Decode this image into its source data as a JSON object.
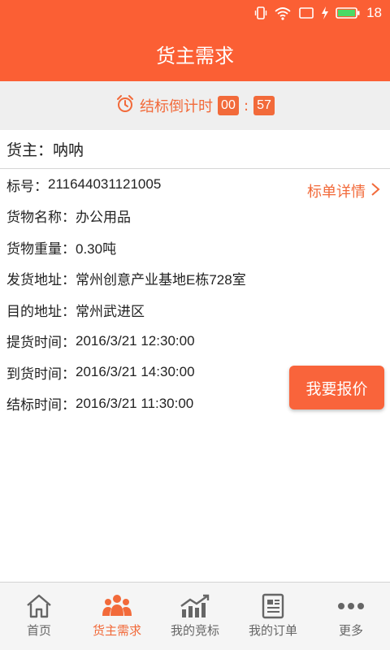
{
  "status_bar": {
    "battery_level": "18",
    "accent": "#fb5f34"
  },
  "header": {
    "title": "货主需求"
  },
  "countdown": {
    "label": "结标倒计时",
    "minutes": "00",
    "separator": ":",
    "seconds": "57"
  },
  "owner": {
    "label": "货主：",
    "name": "呐呐"
  },
  "details": [
    {
      "label": "标号：",
      "value": "211644031121005"
    },
    {
      "label": "货物名称：",
      "value": "办公用品"
    },
    {
      "label": "货物重量：",
      "value": "0.30吨"
    },
    {
      "label": "发货地址：",
      "value": "常州创意产业基地E栋728室"
    },
    {
      "label": "目的地址：",
      "value": "常州武进区"
    },
    {
      "label": "提货时间：",
      "value": "2016/3/21 12:30:00"
    },
    {
      "label": "到货时间：",
      "value": "2016/3/21 14:30:00"
    },
    {
      "label": "结标时间：",
      "value": "2016/3/21 11:30:00"
    }
  ],
  "detail_link": {
    "label": "标单详情"
  },
  "quote_button": {
    "label": "我要报价"
  },
  "tabs": [
    {
      "label": "首页",
      "icon": "home-icon",
      "active": false
    },
    {
      "label": "货主需求",
      "icon": "people-icon",
      "active": true
    },
    {
      "label": "我的竞标",
      "icon": "chart-icon",
      "active": false
    },
    {
      "label": "我的订单",
      "icon": "document-icon",
      "active": false
    },
    {
      "label": "更多",
      "icon": "more-icon",
      "active": false
    }
  ],
  "colors": {
    "brand": "#fb5f34",
    "accent_text": "#f26a3a",
    "inactive_tab": "#666666"
  }
}
